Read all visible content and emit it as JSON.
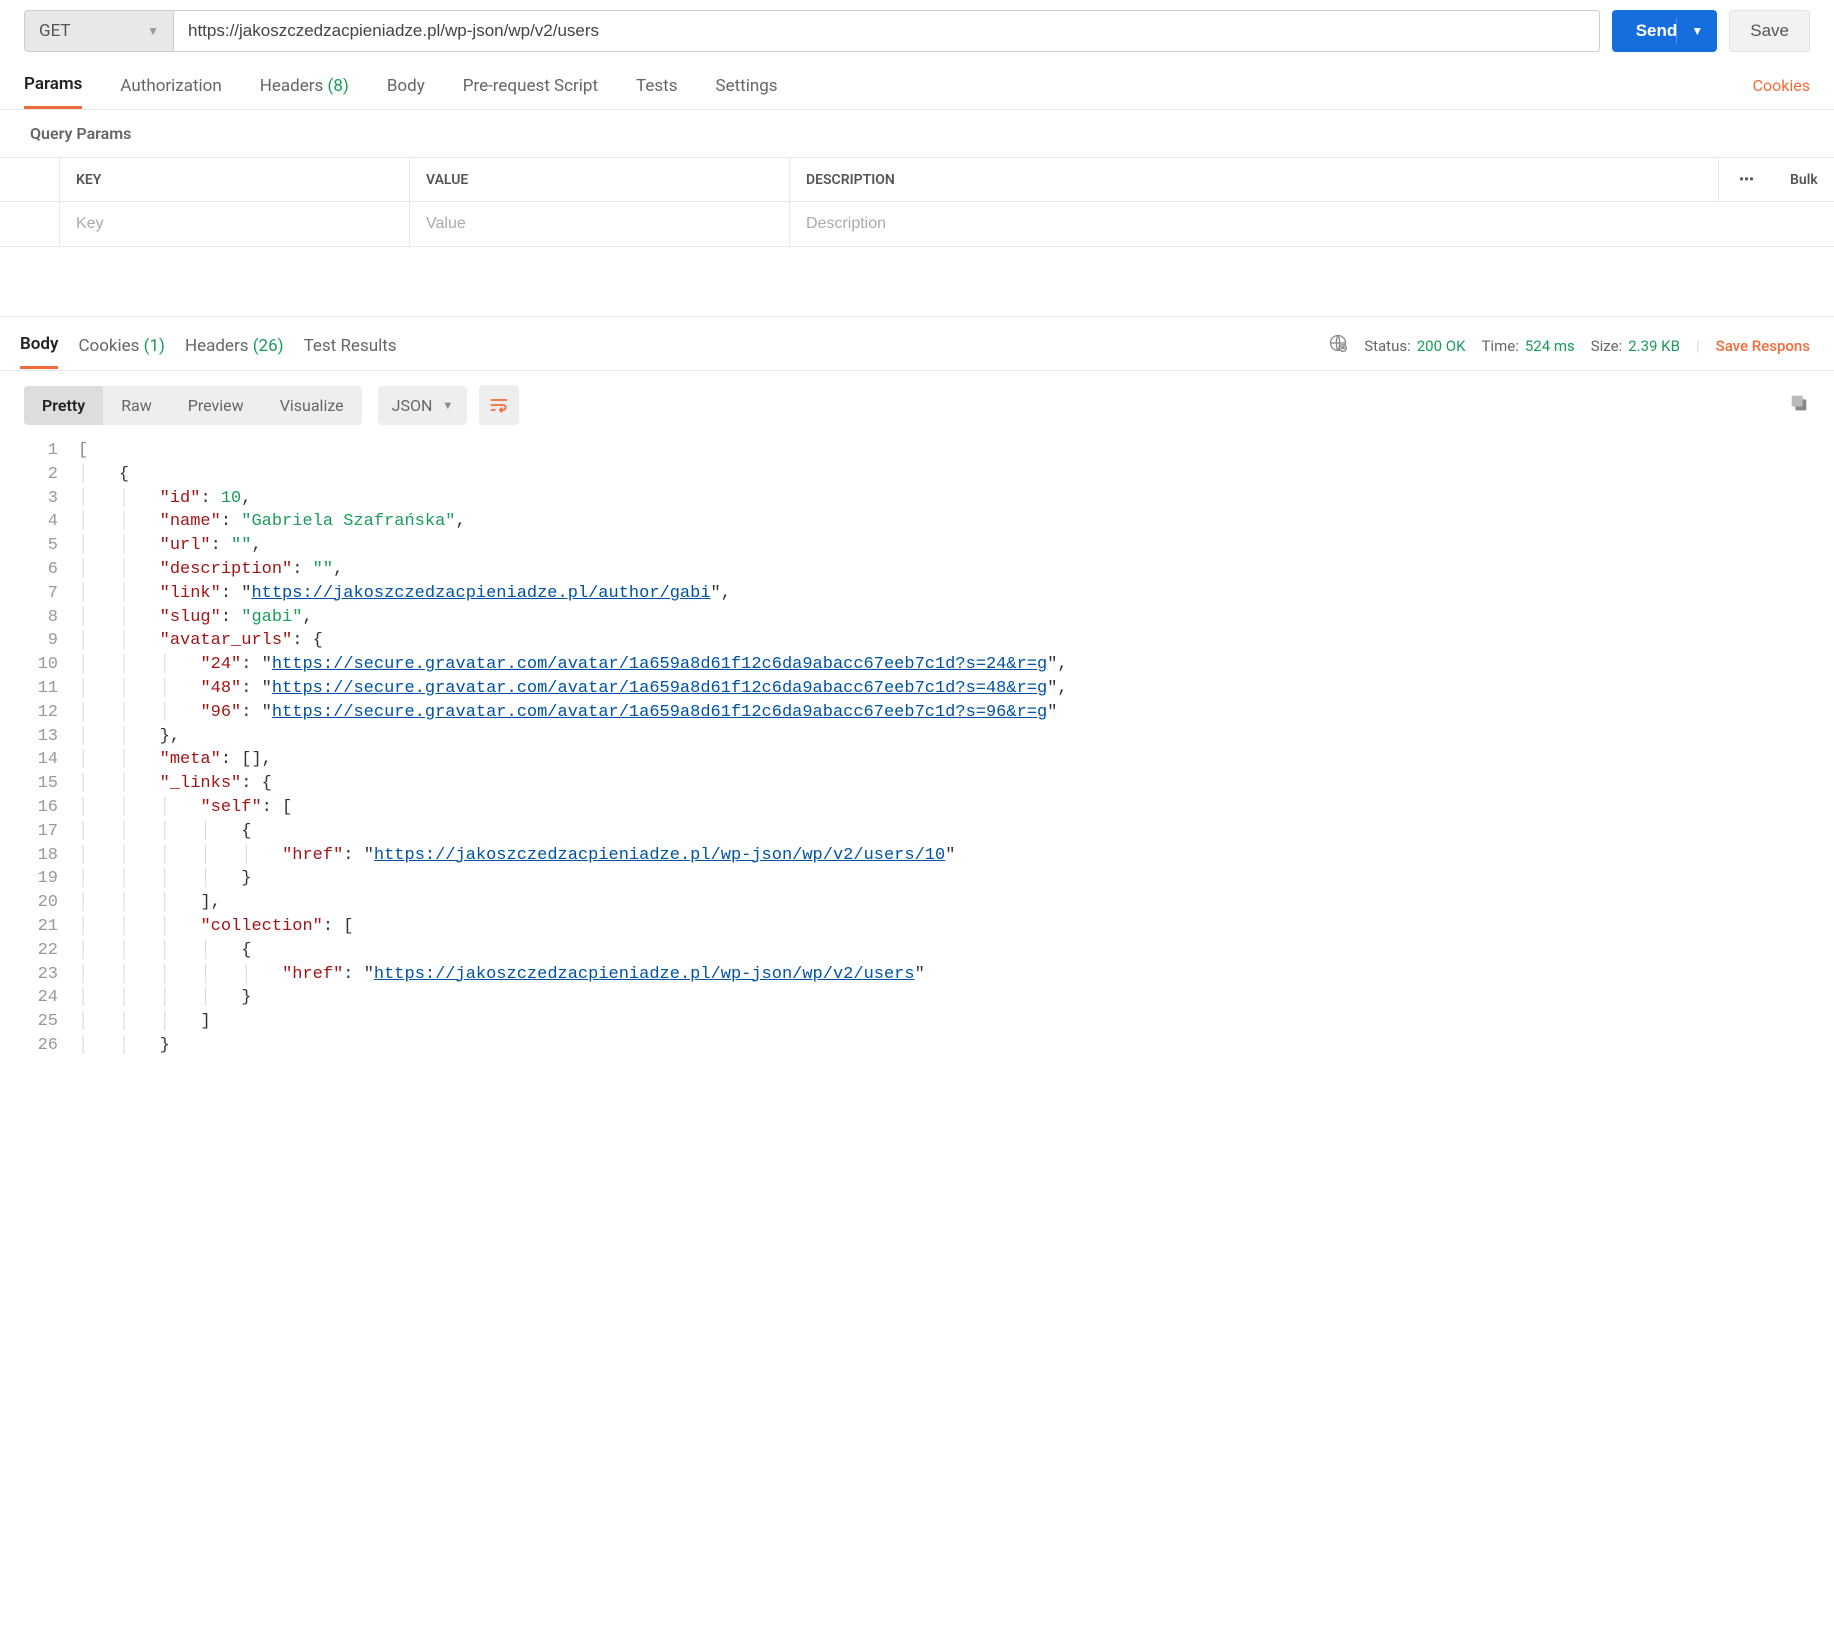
{
  "request": {
    "method": "GET",
    "url": "https://jakoszczedzacpieniadze.pl/wp-json/wp/v2/users",
    "send_label": "Send",
    "save_label": "Save"
  },
  "req_tabs": {
    "params": "Params",
    "authorization": "Authorization",
    "headers": "Headers",
    "headers_count": "(8)",
    "body": "Body",
    "prerequest": "Pre-request Script",
    "tests": "Tests",
    "settings": "Settings",
    "cookies_link": "Cookies"
  },
  "query_params_label": "Query Params",
  "params_table": {
    "key_header": "KEY",
    "value_header": "VALUE",
    "desc_header": "DESCRIPTION",
    "bulk_label": "Bulk",
    "key_placeholder": "Key",
    "value_placeholder": "Value",
    "desc_placeholder": "Description"
  },
  "resp_tabs": {
    "body": "Body",
    "cookies": "Cookies",
    "cookies_count": "(1)",
    "headers": "Headers",
    "headers_count": "(26)",
    "test_results": "Test Results"
  },
  "resp_meta": {
    "status_label": "Status:",
    "status_value": "200 OK",
    "time_label": "Time:",
    "time_value": "524 ms",
    "size_label": "Size:",
    "size_value": "2.39 KB",
    "save_response": "Save Respons"
  },
  "view_modes": {
    "pretty": "Pretty",
    "raw": "Raw",
    "preview": "Preview",
    "visualize": "Visualize",
    "format": "JSON"
  },
  "response_body": {
    "id": 10,
    "name": "Gabriela Szafrańska",
    "url_value": "",
    "description": "",
    "link": "https://jakoszczedzacpieniadze.pl/author/gabi",
    "slug": "gabi",
    "avatar_24": "https://secure.gravatar.com/avatar/1a659a8d61f12c6da9abacc67eeb7c1d?s=24&r=g",
    "avatar_48": "https://secure.gravatar.com/avatar/1a659a8d61f12c6da9abacc67eeb7c1d?s=48&r=g",
    "avatar_96": "https://secure.gravatar.com/avatar/1a659a8d61f12c6da9abacc67eeb7c1d?s=96&r=g",
    "self_href": "https://jakoszczedzacpieniadze.pl/wp-json/wp/v2/users/10",
    "collection_href": "https://jakoszczedzacpieniadze.pl/wp-json/wp/v2/users"
  }
}
